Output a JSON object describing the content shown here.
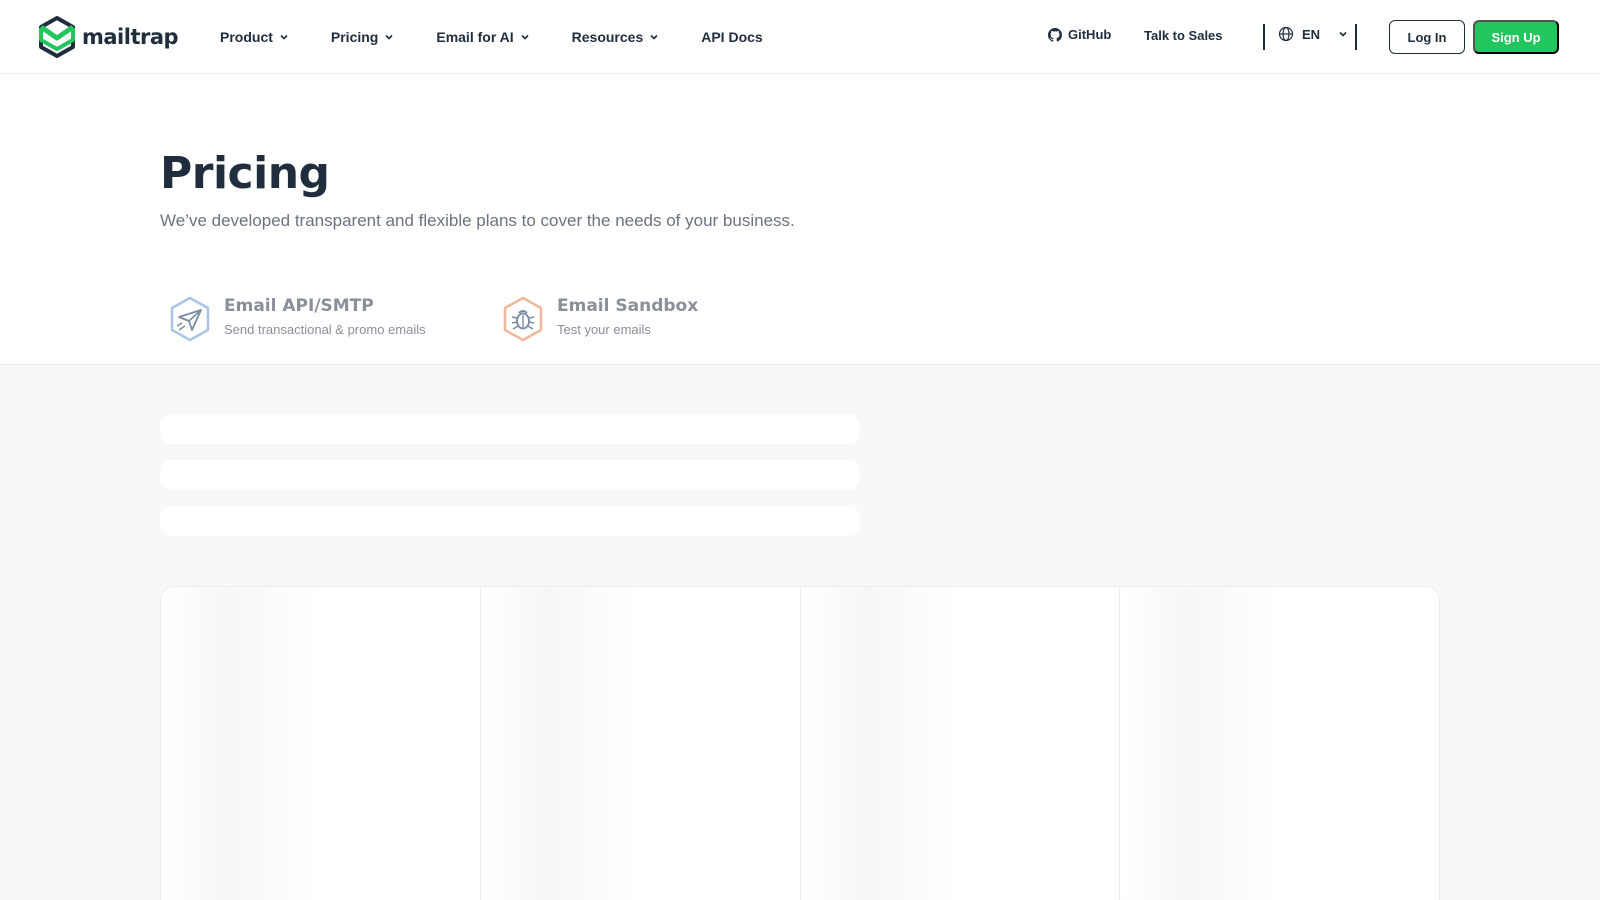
{
  "brand": {
    "name": "mailtrap",
    "accent": "#22c55e",
    "dark": "#1f2d3d"
  },
  "nav": {
    "items": [
      {
        "label": "Product",
        "dropdown": true
      },
      {
        "label": "Pricing",
        "dropdown": true
      },
      {
        "label": "Email for AI",
        "dropdown": true
      },
      {
        "label": "Resources",
        "dropdown": true
      },
      {
        "label": "API Docs",
        "dropdown": false
      }
    ],
    "github_label": "GitHub",
    "sales_label": "Talk to Sales",
    "language": "EN",
    "login_label": "Log In",
    "signup_label": "Sign Up"
  },
  "hero": {
    "title": "Pricing",
    "subtitle": "We’ve developed transparent and flexible plans to cover the needs of your business."
  },
  "tabs": [
    {
      "title": "Email API/SMTP",
      "subtitle": "Send transactional & promo emails",
      "icon": "paper-plane-icon",
      "icon_color": "#7da7d9"
    },
    {
      "title": "Email Sandbox",
      "subtitle": "Test your emails",
      "icon": "bug-icon",
      "icon_color": "#e8a077"
    }
  ],
  "loading_placeholders": {
    "lines": 3,
    "cards": 4
  }
}
